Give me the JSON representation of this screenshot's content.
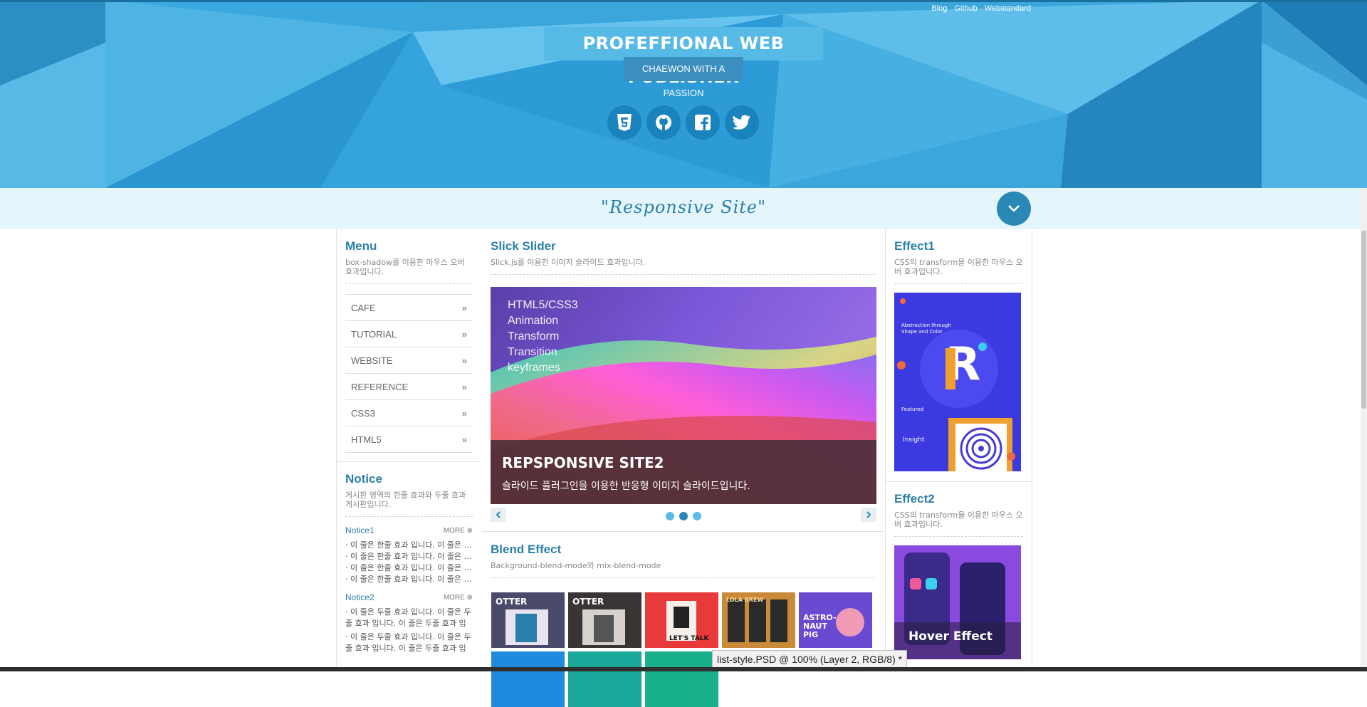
{
  "top_links": [
    "Blog",
    "Github",
    "Webstandard"
  ],
  "header": {
    "title": "PROFEFFIONAL WEB PUBLISHER",
    "subtitle": "CHAEWON WITH A PASSION",
    "social_icons": [
      "html5-icon",
      "github-icon",
      "facebook-icon",
      "twitter-icon"
    ]
  },
  "band": {
    "title": "\"Responsive Site\""
  },
  "menu": {
    "title": "Menu",
    "desc": "box-shadow를 이용한 마우스 오버 효과입니다.",
    "items": [
      "CAFE",
      "TUTORIAL",
      "WEBSITE",
      "REFERENCE",
      "CSS3",
      "HTML5"
    ]
  },
  "notice": {
    "title": "Notice",
    "desc": "게시판 영역의 한줄 효과와 두줄 효과 게시판입니다.",
    "more": "MORE",
    "groups": [
      {
        "label": "Notice1",
        "lines": [
          "이 줄은 한줄 효과 입니다. 이 줄은 한줄 효과",
          "이 줄은 한줄 효과 입니다. 이 줄은 한줄 효과",
          "이 줄은 한줄 효과 입니다. 이 줄은 한줄 효과",
          "이 줄은 한줄 효과 입니다. 이 줄은 한줄 효과"
        ]
      },
      {
        "label": "Notice2",
        "lines": [
          "이 줄은 두줄 효과 입니다. 이 줄은 두줄 효과 입니다. 이 줄은 두줄 효과 입니다.",
          "이 줄은 두줄 효과 입니다. 이 줄은 두줄 효과 입니다. 이 줄은 두줄 효과 입니다."
        ]
      }
    ]
  },
  "slider": {
    "title": "Slick Slider",
    "desc": "Slick.js를 이용한 이미지 슬라이드 효과입니다.",
    "lines": [
      "HTML5/CSS3",
      "Animation",
      "Transform",
      "Transition",
      "keyframes"
    ],
    "caption_title": "REPSPONSIVE SITE2",
    "caption_text": "슬라이드 플러그인을 이용한 반응형 이미지 슬라이드입니다.",
    "dot_count": 3,
    "active_dot": 2
  },
  "blend": {
    "title": "Blend Effect",
    "desc": "Background-blend-mode와 mix-blend-mode",
    "thumbs": [
      {
        "label": "OTTER",
        "color": "#4a4a6a"
      },
      {
        "label": "OTTER",
        "color": "#3a3435"
      },
      {
        "label": "LET'S TALK",
        "color": "#e83a3a"
      },
      {
        "label": "LOLA BREW",
        "color": "#c98a3a"
      },
      {
        "label": "ASTRO-NAUT PIG",
        "color": "#6a4ad0"
      }
    ]
  },
  "effect1": {
    "title": "Effect1",
    "desc": "CSS의 transform을 이용한 마우스 오버 효과입니다.",
    "card_heading": "Abstraction through Shape and Color",
    "card_letter": "R",
    "card_featured": "Featured",
    "card_insight": "Insight"
  },
  "effect2": {
    "title": "Effect2",
    "desc": "CSS의 transform을 이용한 마우스 오버 효과입니다.",
    "hover_label": "Hover Effect"
  },
  "status_bar": {
    "text": "list-style.PSD @ 100% (Layer 2, RGB/8) *"
  },
  "colors": {
    "accent": "#2a7fa8",
    "hero": "#3aa6dc",
    "band": "#e4f5fc"
  }
}
